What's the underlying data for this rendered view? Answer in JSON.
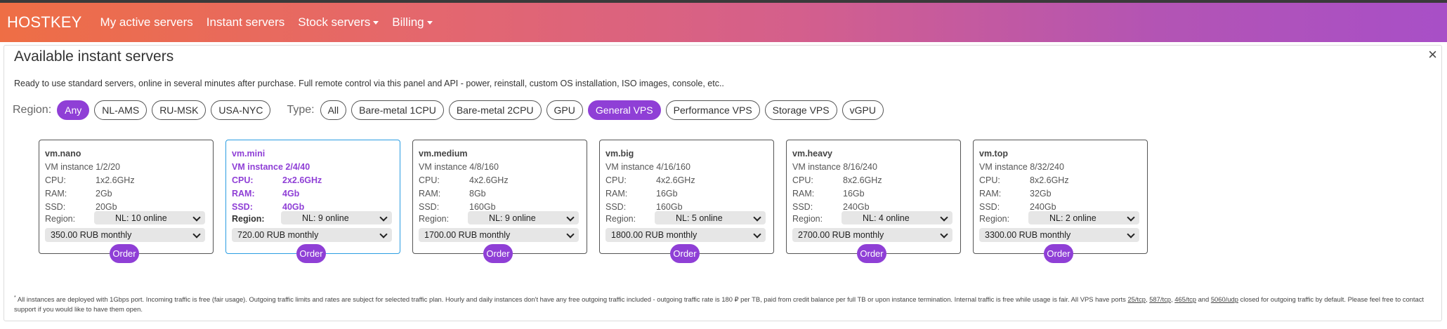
{
  "nav": {
    "brand": "HOSTKEY",
    "links": [
      "My active servers",
      "Instant servers",
      "Stock servers",
      "Billing"
    ]
  },
  "panel": {
    "title": "Available instant servers",
    "close_icon": "×",
    "description": "Ready to use standard servers, online in several minutes after purchase. Full remote control via this panel and API - power, reinstall, custom OS installation, ISO images, console, etc.."
  },
  "filters": {
    "region_label": "Region:",
    "regions": [
      "Any",
      "NL-AMS",
      "RU-MSK",
      "USA-NYC"
    ],
    "region_selected": "Any",
    "type_label": "Type:",
    "types": [
      "All",
      "Bare-metal 1CPU",
      "Bare-metal 2CPU",
      "GPU",
      "General VPS",
      "Performance VPS",
      "Storage VPS",
      "vGPU"
    ],
    "type_selected": "General VPS"
  },
  "spec_labels": {
    "cpu": "CPU:",
    "ram": "RAM:",
    "ssd": "SSD:",
    "region": "Region:"
  },
  "order_label": "Order",
  "servers": [
    {
      "name": "vm.nano",
      "instance": "VM instance 1/2/20",
      "cpu": "1x2.6GHz",
      "ram": "2Gb",
      "ssd": "20Gb",
      "region": "NL: 10 online",
      "price": "350.00 RUB monthly"
    },
    {
      "name": "vm.mini",
      "instance": "VM instance 2/4/40",
      "cpu": "2x2.6GHz",
      "ram": "4Gb",
      "ssd": "40Gb",
      "region": "NL: 9 online",
      "price": "720.00 RUB monthly"
    },
    {
      "name": "vm.medium",
      "instance": "VM instance 4/8/160",
      "cpu": "4x2.6GHz",
      "ram": "8Gb",
      "ssd": "160Gb",
      "region": "NL: 9 online",
      "price": "1700.00 RUB monthly"
    },
    {
      "name": "vm.big",
      "instance": "VM instance 4/16/160",
      "cpu": "4x2.6GHz",
      "ram": "16Gb",
      "ssd": "160Gb",
      "region": "NL: 5 online",
      "price": "1800.00 RUB monthly"
    },
    {
      "name": "vm.heavy",
      "instance": "VM instance 8/16/240",
      "cpu": "8x2.6GHz",
      "ram": "16Gb",
      "ssd": "240Gb",
      "region": "NL: 4 online",
      "price": "2700.00 RUB monthly"
    },
    {
      "name": "vm.top",
      "instance": "VM instance 8/32/240",
      "cpu": "8x2.6GHz",
      "ram": "32Gb",
      "ssd": "240Gb",
      "region": "NL: 2 online",
      "price": "3300.00 RUB monthly"
    }
  ],
  "footnote": {
    "mark": "*",
    "text_before": " All instances are deployed with 1Gbps port. Incoming traffic is free (fair usage). Outgoing traffic limits and rates are subject for selected traffic plan. Hourly and daily instances don't have any free outgoing traffic included - outgoing traffic rate is 180 ₽ per TB, paid from credit balance per full TB or upon instance termination. Internal traffic is free while usage is fair. All VPS have ports ",
    "port1": "25/tcp",
    "sep1": ", ",
    "port2": "587/tcp",
    "sep2": ", ",
    "port3": "465/tcp",
    "sep3": " and ",
    "port4": "5060/udp",
    "text_after": " closed for outgoing traffic by default. Please feel free to contact support if you would like to have them open."
  }
}
